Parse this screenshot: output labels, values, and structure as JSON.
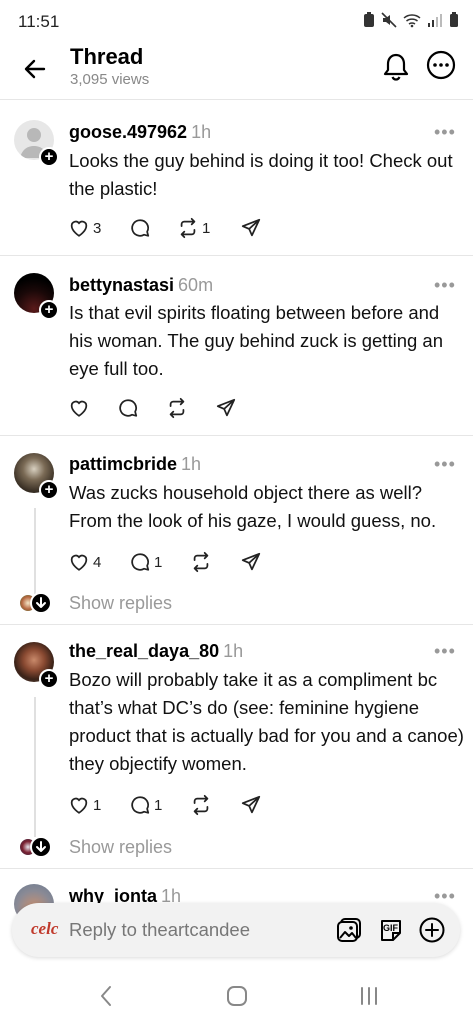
{
  "status": {
    "time": "11:51"
  },
  "header": {
    "title": "Thread",
    "views": "3,095 views"
  },
  "posts": [
    {
      "username": "goose.497962",
      "time": "1h",
      "text": "Looks the guy behind is doing it too! Check out the plastic!",
      "likes": "3",
      "comments": "",
      "reposts": "1"
    },
    {
      "username": "bettynastasi",
      "time": "60m",
      "text": "Is that evil spirits floating between before and his woman. The guy behind zuck is getting an eye full too.",
      "likes": "",
      "comments": "",
      "reposts": ""
    },
    {
      "username": "pattimcbride",
      "time": "1h",
      "text": "Was zucks household object there as well? From the look of his gaze, I would guess, no.",
      "likes": "4",
      "comments": "1",
      "reposts": "",
      "show_replies": "Show replies"
    },
    {
      "username": "the_real_daya_80",
      "time": "1h",
      "text": "Bozo will probably take it as a compliment bc that’s what DC’s do (see: feminine hygiene product that is actually bad for you and a canoe) they objectify women.",
      "likes": "1",
      "comments": "1",
      "reposts": "",
      "show_replies": "Show replies"
    },
    {
      "username": "why_ionta",
      "time": "1h"
    }
  ],
  "more_label": "•••",
  "reply_bar": {
    "logo": "celc",
    "placeholder": "Reply to theartcandee",
    "gif_label": "GIF"
  },
  "colors": {
    "muted": "#999999",
    "divider": "#e6e6e6",
    "reply_bg": "#f2f2f2"
  },
  "icons": [
    "back-arrow-icon",
    "bell-icon",
    "more-circle-icon",
    "heart-icon",
    "comment-icon",
    "repost-icon",
    "share-icon",
    "image-icon",
    "gif-icon",
    "plus-circle-icon"
  ]
}
